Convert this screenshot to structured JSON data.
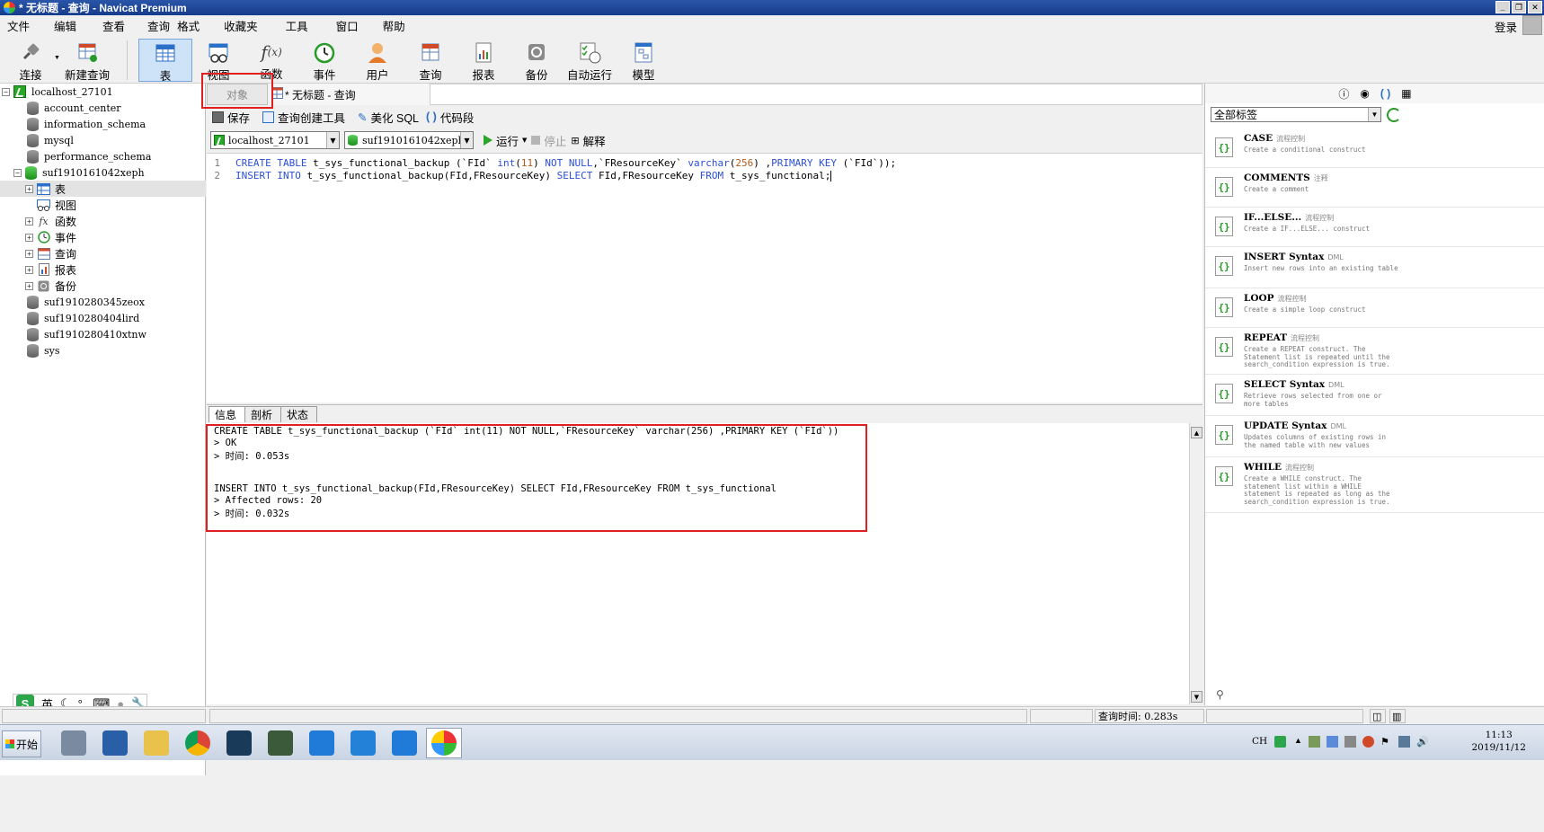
{
  "window": {
    "title": "* 无标题 - 查询 - Navicat Premium"
  },
  "menu": [
    "文件",
    "编辑",
    "查看",
    "查询",
    "格式",
    "收藏夹",
    "工具",
    "窗口",
    "帮助"
  ],
  "login": "登录",
  "toolbar": {
    "buttons": [
      {
        "label": "连接",
        "icon": "plug-icon"
      },
      {
        "label": "新建查询",
        "icon": "new-query-icon"
      },
      {
        "label": "表",
        "icon": "table-icon",
        "active": true
      },
      {
        "label": "视图",
        "icon": "view-icon"
      },
      {
        "label": "函数",
        "icon": "function-icon"
      },
      {
        "label": "事件",
        "icon": "clock-icon"
      },
      {
        "label": "用户",
        "icon": "user-icon"
      },
      {
        "label": "查询",
        "icon": "query-icon"
      },
      {
        "label": "报表",
        "icon": "report-icon"
      },
      {
        "label": "备份",
        "icon": "backup-icon"
      },
      {
        "label": "自动运行",
        "icon": "schedule-icon"
      },
      {
        "label": "模型",
        "icon": "model-icon"
      }
    ]
  },
  "tree": {
    "connection": "localhost_27101",
    "databases_before": [
      "account_center",
      "information_schema",
      "mysql",
      "performance_schema"
    ],
    "open_db": "suf1910161042xeph",
    "children": [
      "表",
      "视图",
      "函数",
      "事件",
      "查询",
      "报表",
      "备份"
    ],
    "databases_after": [
      "suf1910280345zeox",
      "suf1910280404lird",
      "suf1910280410xtnw",
      "sys"
    ]
  },
  "ime": {
    "logo": "S",
    "mode": "英"
  },
  "tabs": {
    "object": "对象",
    "query": "* 无标题 - 查询"
  },
  "query_toolbar": {
    "save": "保存",
    "builder": "查询创建工具",
    "beautify": "美化 SQL",
    "snippet": "代码段"
  },
  "selectors": {
    "connection": "localhost_27101",
    "database": "suf1910161042xeph",
    "run": "运行",
    "stop": "停止",
    "explain": "解释"
  },
  "editor": {
    "lines": [
      {
        "n": "1"
      },
      {
        "n": "2"
      }
    ]
  },
  "result_tabs": [
    "信息",
    "剖析",
    "状态"
  ],
  "result_lines": [
    "CREATE TABLE t_sys_functional_backup (`FId` int(11) NOT NULL,`FResourceKey` varchar(256) ,PRIMARY KEY (`FId`))",
    "> OK",
    "> 时间: 0.053s",
    "",
    "",
    "INSERT INTO t_sys_functional_backup(FId,FResourceKey) SELECT FId,FResourceKey FROM t_sys_functional",
    "> Affected rows: 20",
    "> 时间: 0.032s"
  ],
  "status": {
    "query_time": "查询时间: 0.283s"
  },
  "right_panel": {
    "tag_filter": "全部标签",
    "snippets": [
      {
        "title": "CASE",
        "tag": "流程控制",
        "desc": "Create a conditional construct"
      },
      {
        "title": "COMMENTS",
        "tag": "注释",
        "desc": "Create a comment"
      },
      {
        "title": "IF...ELSE...",
        "tag": "流程控制",
        "desc": "Create a IF...ELSE... construct"
      },
      {
        "title": "INSERT Syntax",
        "tag": "DML",
        "desc": "Insert new rows into an existing table"
      },
      {
        "title": "LOOP",
        "tag": "流程控制",
        "desc": "Create a simple loop construct"
      },
      {
        "title": "REPEAT",
        "tag": "流程控制",
        "desc": "Create a REPEAT construct. The Statement list is repeated until the search_condition expression is true."
      },
      {
        "title": "SELECT Syntax",
        "tag": "DML",
        "desc": "Retrieve rows selected from one or more tables"
      },
      {
        "title": "UPDATE Syntax",
        "tag": "DML",
        "desc": "Updates columns of existing rows in the named table with new values"
      },
      {
        "title": "WHILE",
        "tag": "流程控制",
        "desc": "Create a WHILE construct. The statement list within a WHILE statement is repeated as long as the search_condition expression is true."
      }
    ]
  },
  "taskbar": {
    "start": "开始",
    "lang": "CH",
    "time": "11:13",
    "date": "2019/11/12"
  }
}
